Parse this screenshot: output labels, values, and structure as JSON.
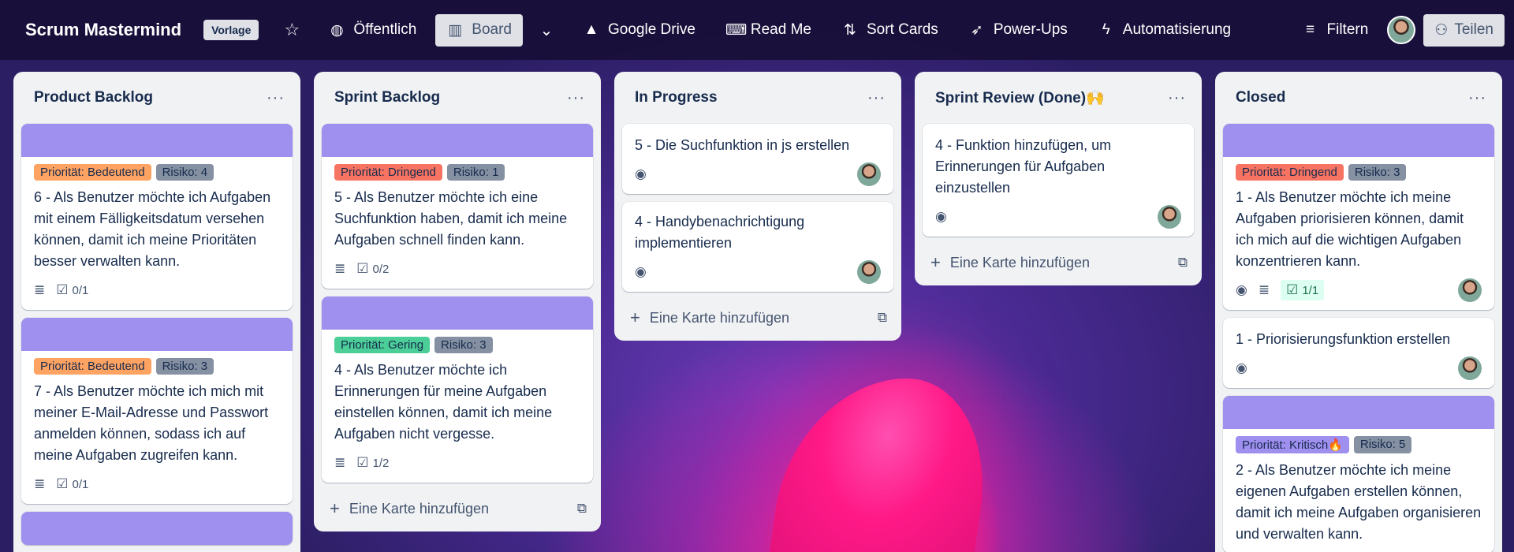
{
  "header": {
    "board_title": "Scrum Mastermind",
    "template_badge": "Vorlage",
    "visibility": "Öffentlich",
    "view": "Board",
    "google_drive": "Google Drive",
    "read_me": "Read Me",
    "sort_cards": "Sort Cards",
    "power_ups": "Power-Ups",
    "automation": "Automatisierung",
    "filter": "Filtern",
    "share": "Teilen"
  },
  "add_card_label": "Eine Karte hinzufügen",
  "lists": [
    {
      "title": "Product Backlog",
      "cards": [
        {
          "labels": [
            "Priorität: Bedeutend",
            "Risiko: 4"
          ],
          "text": "6 - Als Benutzer möchte ich Aufgaben mit einem Fälligkeitsdatum versehen können, damit ich meine Prioritäten besser verwalten kann.",
          "checklist": "0/1"
        },
        {
          "labels": [
            "Priorität: Bedeutend",
            "Risiko: 3"
          ],
          "text": "7 - Als Benutzer möchte ich mich mit meiner E-Mail-Adresse und Passwort anmelden können, sodass ich auf meine Aufgaben zugreifen kann.",
          "checklist": "0/1"
        }
      ]
    },
    {
      "title": "Sprint Backlog",
      "cards": [
        {
          "labels": [
            "Priorität: Dringend",
            "Risiko: 1"
          ],
          "text": "5 - Als Benutzer möchte ich eine Suchfunktion haben, damit ich meine Aufgaben schnell finden kann.",
          "checklist": "0/2"
        },
        {
          "labels": [
            "Priorität: Gering",
            "Risiko: 3"
          ],
          "text": "4 - Als Benutzer möchte ich Erinnerungen für meine Aufgaben einstellen können, damit ich meine Aufgaben nicht vergesse.",
          "checklist": "1/2"
        }
      ]
    },
    {
      "title": "In Progress",
      "cards": [
        {
          "text": "5 - Die Suchfunktion in js erstellen"
        },
        {
          "text": "4 - Handybenachrichtigung implementieren"
        }
      ]
    },
    {
      "title": "Sprint Review (Done)🙌",
      "cards": [
        {
          "text": "4 - Funktion hinzufügen, um Erinnerungen für Aufgaben einzustellen"
        }
      ]
    },
    {
      "title": "Closed",
      "cards": [
        {
          "labels": [
            "Priorität: Dringend",
            "Risiko: 3"
          ],
          "text": "1 - Als Benutzer möchte ich meine Aufgaben priorisieren können, damit ich mich auf die wichtigen Aufgaben konzentrieren kann.",
          "checklist": "1/1"
        },
        {
          "text": "1 - Priorisierungsfunktion erstellen"
        },
        {
          "labels": [
            "Priorität: Kritisch🔥",
            "Risiko: 5"
          ],
          "text": "2 - Als Benutzer möchte ich meine eigenen Aufgaben erstellen können, damit ich meine Aufgaben organisieren und verwalten kann."
        }
      ]
    }
  ],
  "colors": {
    "cover": "#9f8fef",
    "label_bedeutend": "#fea362",
    "label_dringend": "#f87462",
    "label_gering": "#4bce97",
    "label_kritisch": "#9f8fef",
    "label_risiko": "#8590a2",
    "checklist_done_bg": "#dcfff1"
  }
}
